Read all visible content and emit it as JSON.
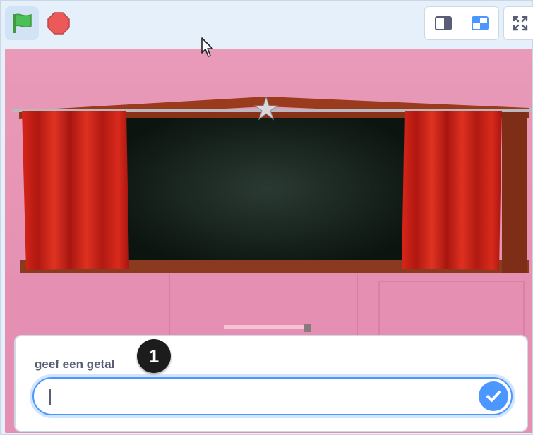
{
  "toolbar": {
    "green_flag_icon": "green-flag-icon",
    "stop_icon": "stop-sign-icon",
    "small_stage_icon": "small-stage-icon",
    "normal_stage_icon": "normal-stage-icon",
    "fullscreen_icon": "fullscreen-icon"
  },
  "ask": {
    "question": "geef een getal",
    "callout_number": "1",
    "answer_value": "",
    "submit_icon": "check-icon"
  },
  "colors": {
    "accent": "#4c97ff",
    "toolbar_bg": "#e6f0fb",
    "flag_green": "#4cbf56",
    "stop_red": "#ec5959",
    "label_text": "#575e75"
  }
}
